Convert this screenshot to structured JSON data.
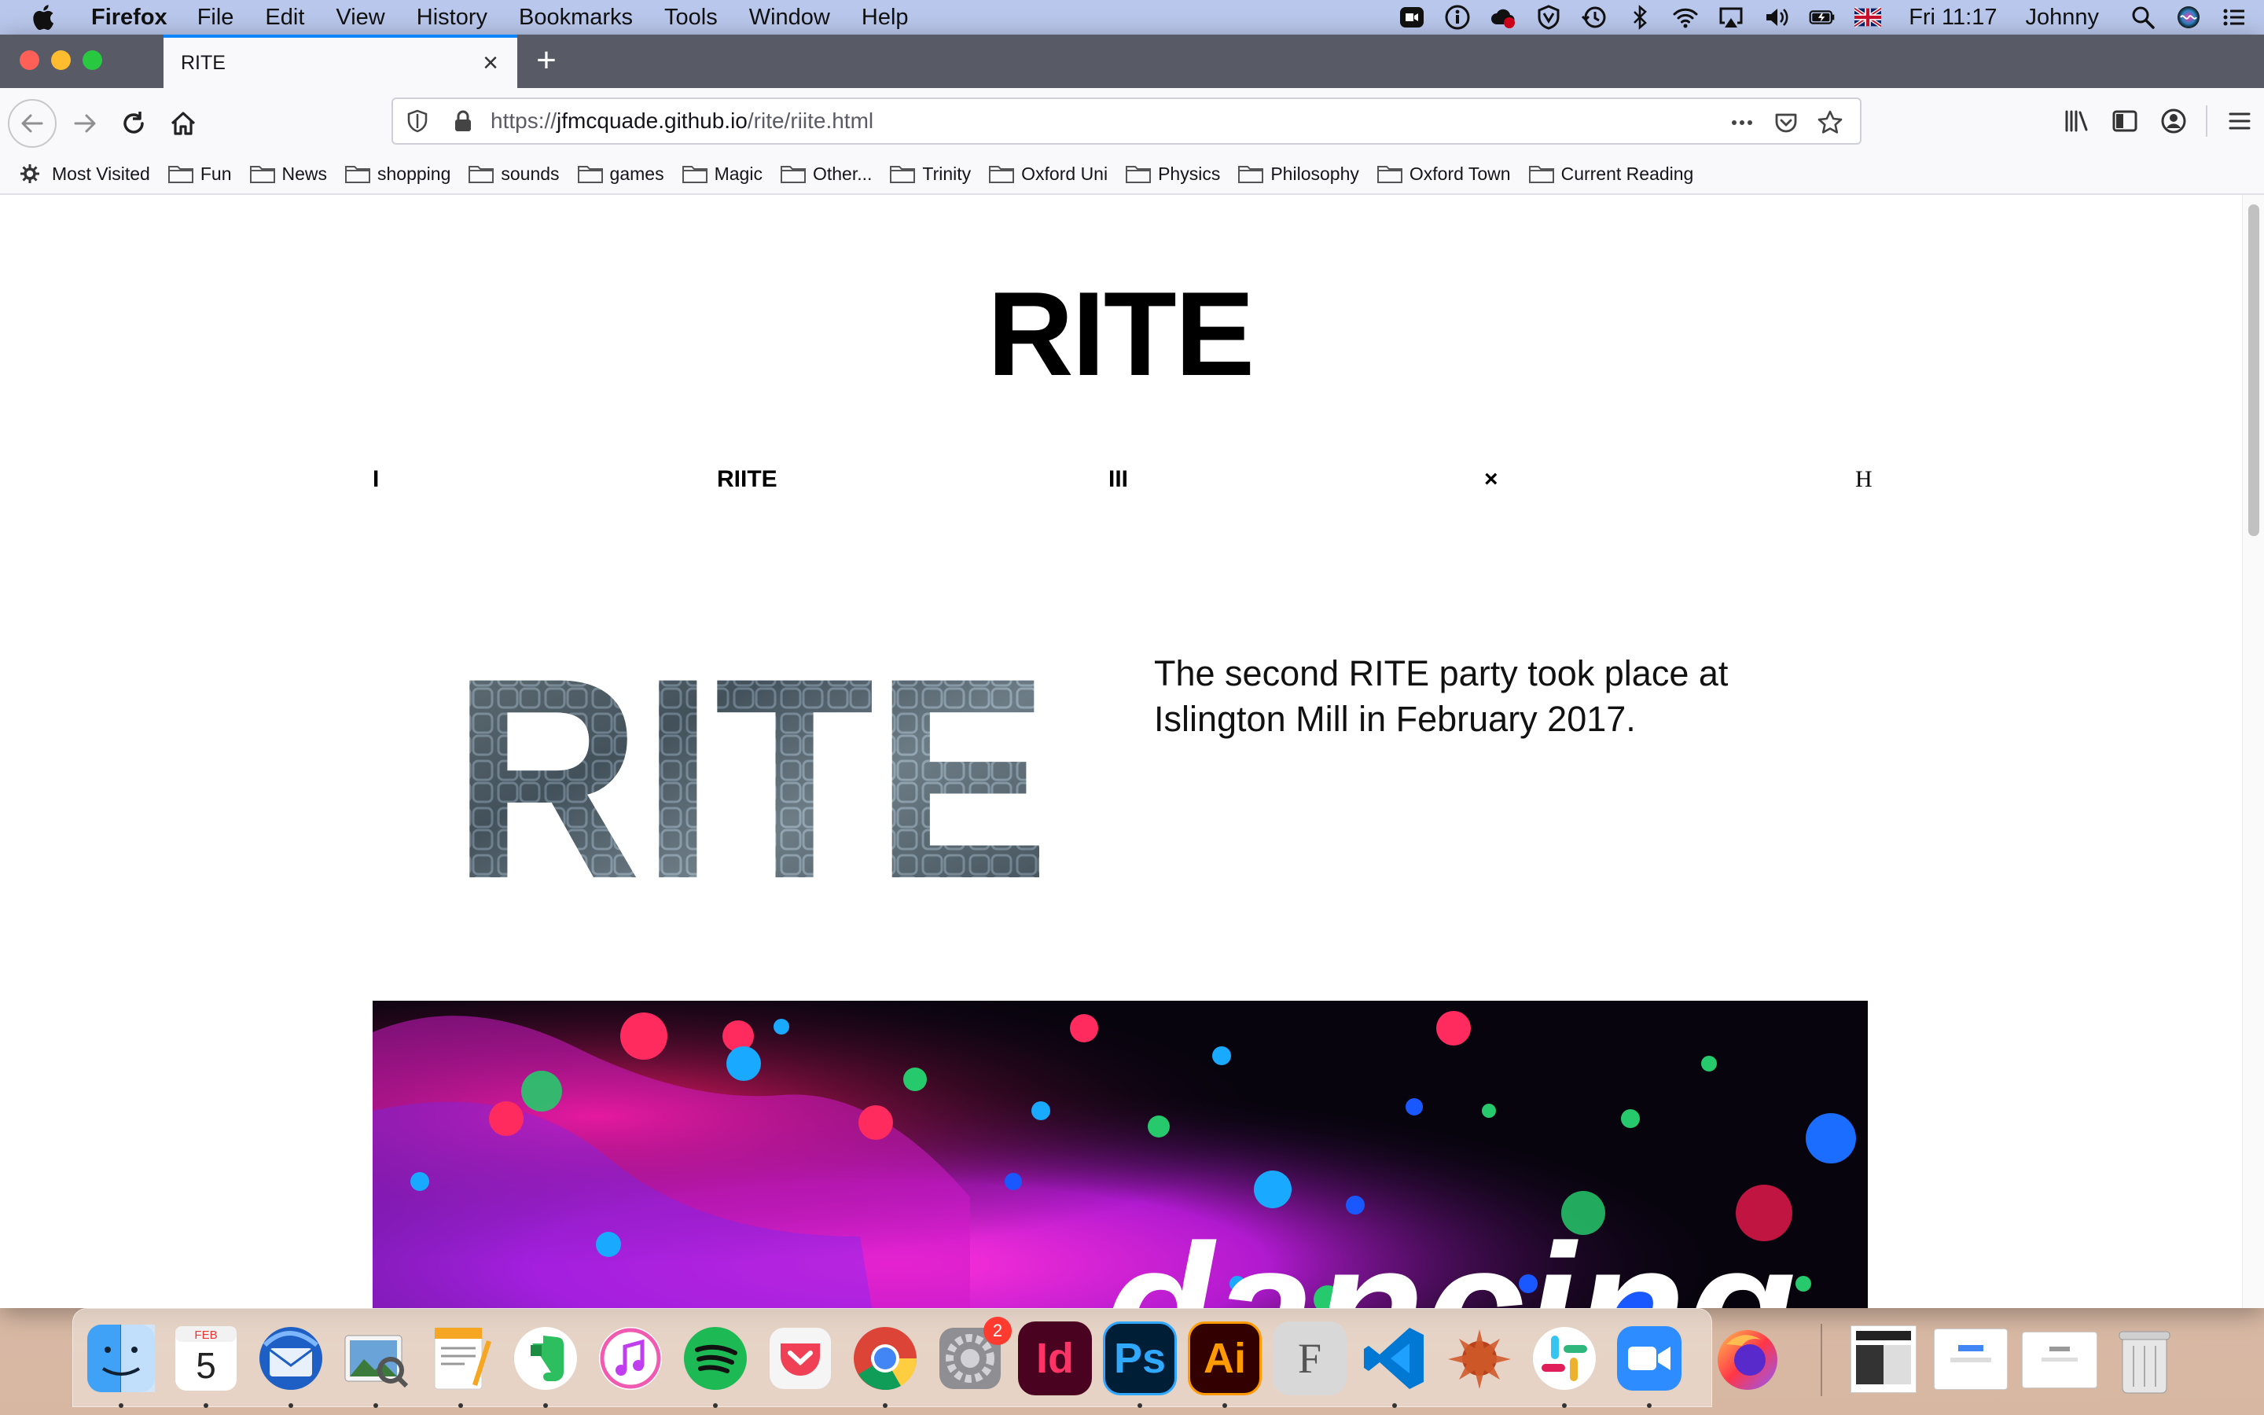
{
  "menubar": {
    "app_name": "Firefox",
    "menus": [
      "File",
      "Edit",
      "View",
      "History",
      "Bookmarks",
      "Tools",
      "Window",
      "Help"
    ],
    "clock": "Fri 11:17",
    "user": "Johnny",
    "status_icons": [
      "zoom-icon",
      "info-icon",
      "creative-cloud-icon",
      "malwarebytes-icon",
      "time-machine-icon",
      "bluetooth-icon",
      "wifi-icon",
      "airplay-icon",
      "volume-icon",
      "battery-icon",
      "uk-flag-icon",
      "spotlight-icon",
      "siri-icon",
      "control-center-icon"
    ]
  },
  "browser": {
    "tab_title": "RITE",
    "url": {
      "prefix": "https://",
      "host": "jfmcquade.github.io",
      "path": "/rite/riite.html"
    },
    "bookmarks": [
      "Most Visited",
      "Fun",
      "News",
      "shopping",
      "sounds",
      "games",
      "Magic",
      "Other...",
      "Trinity",
      "Oxford Uni",
      "Physics",
      "Philosophy",
      "Oxford Town",
      "Current Reading"
    ]
  },
  "page": {
    "title": "RITE",
    "nav": [
      "I",
      "RIITE",
      "III",
      "×",
      "H"
    ],
    "logo_text": "RITE",
    "blurb": "The second RITE party took place at Islington Mill in February 2017.",
    "hero_text": "dancing"
  },
  "dock": {
    "apps": [
      "Finder",
      "Calendar",
      "Thunderbird",
      "Preview",
      "Pages",
      "Evernote",
      "Music",
      "Spotify",
      "Pocket",
      "Chrome",
      "System Preferences",
      "InDesign",
      "Photoshop",
      "Illustrator",
      "Font Book",
      "VS Code",
      "Vivaldi",
      "Slack",
      "Zoom",
      "Firefox"
    ],
    "calendar_month": "FEB",
    "calendar_day": "5",
    "system_prefs_badge": "2",
    "indesign_label": "Id",
    "photoshop_label": "Ps",
    "illustrator_label": "Ai",
    "fontbook_label": "F"
  },
  "colors": {
    "menubar": "#b9c7ec",
    "tabstrip": "#585b66",
    "accent_blue": "#0a84ff",
    "hero_magenta": "#e018c8"
  }
}
